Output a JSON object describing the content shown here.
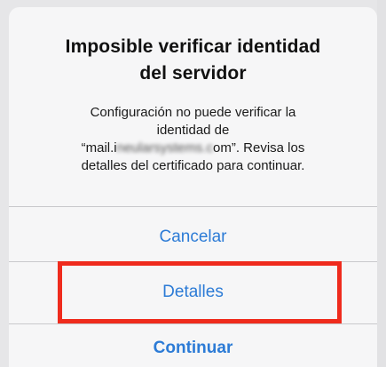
{
  "dialog": {
    "title_line1": "Imposible verificar identidad",
    "title_line2": "del servidor",
    "message_line1": "Configuración no puede verificar la",
    "message_line2": "identidad de",
    "message_line3_prefix": "“mail.i",
    "message_line3_obscured": "neularsystems.c",
    "message_line3_suffix": "om”. Revisa los",
    "message_line4": "detalles del certificado para continuar."
  },
  "actions": {
    "cancel_label": "Cancelar",
    "details_label": "Detalles",
    "continue_label": "Continuar"
  },
  "colors": {
    "action": "#2c7bd6",
    "highlight": "#ef2b1d"
  }
}
